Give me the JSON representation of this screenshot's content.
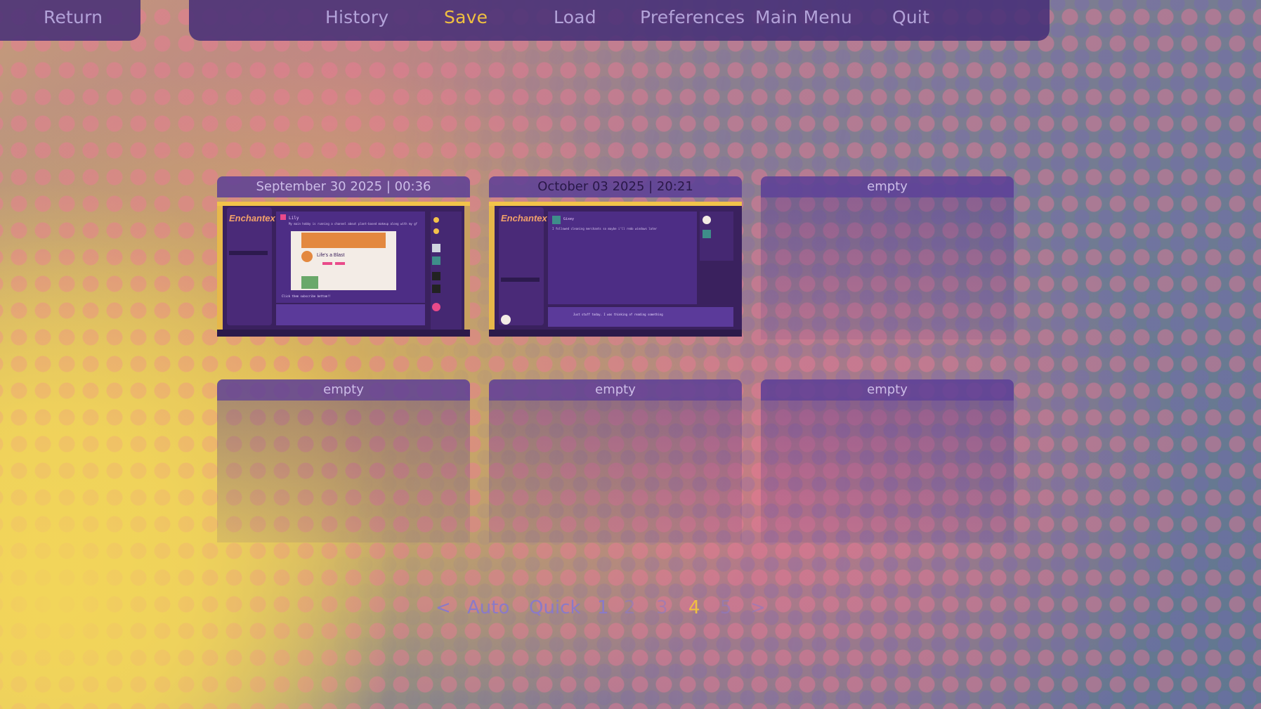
{
  "nav": {
    "return_label": "Return",
    "history_label": "History",
    "save_label": "Save",
    "load_label": "Load",
    "preferences_label": "Preferences",
    "main_menu_label": "Main Menu",
    "quit_label": "Quit",
    "active_item": "Save"
  },
  "slots": [
    {
      "header": "September 30 2025  |  00:36",
      "has_thumbnail": true
    },
    {
      "header": "October 03 2025  |  20:21",
      "has_thumbnail": true
    },
    {
      "header": "empty",
      "has_thumbnail": false
    },
    {
      "header": "empty",
      "has_thumbnail": false
    },
    {
      "header": "empty",
      "has_thumbnail": false
    },
    {
      "header": "empty",
      "has_thumbnail": false
    }
  ],
  "thumbnails": [
    {
      "logo_text": "Enchantex",
      "card_title": "Life's a Blast",
      "chat_title": "Lily",
      "chat_line": "My main hobby is running a channel about plant-based makeup along with my gf",
      "caption": "Click them subscribe bottom!!"
    },
    {
      "logo_text": "Enchantex",
      "chat_title": "Gixey",
      "chat_line": "I followed cleaning merchants so maybe i'll redo windows later",
      "caption": "Just stuff today. I was thinking of reading something"
    }
  ],
  "pagination": {
    "prev": "<",
    "auto": "Auto",
    "quick": "Quick",
    "pages": [
      "1",
      "2",
      "3",
      "4",
      "5"
    ],
    "active_page": "4",
    "next": ">"
  },
  "colors": {
    "accent": "#f0c040",
    "nav_text": "#b3a3d9",
    "bar_bg": "#483078",
    "pager_text": "#8a7ac8"
  }
}
